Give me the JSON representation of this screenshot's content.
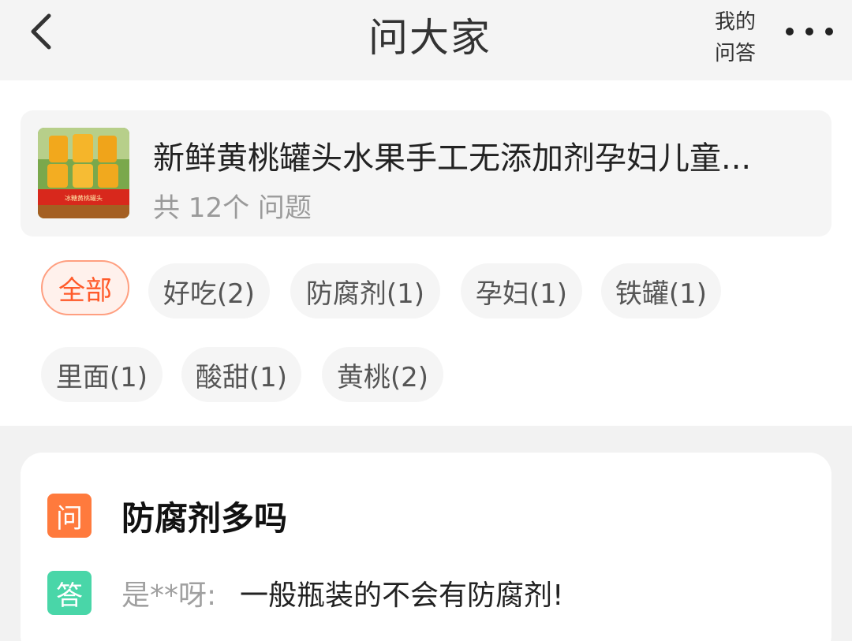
{
  "header": {
    "title": "问大家",
    "my_qa_line1": "我的",
    "my_qa_line2": "问答"
  },
  "product": {
    "title": "新鲜黄桃罐头水果手工无添加剂孕妇儿童...",
    "question_count": "共 12个 问题",
    "thumb_label": "冰糖黄桃罐头"
  },
  "tags": [
    {
      "label": "全部",
      "active": true
    },
    {
      "label": "好吃(2)"
    },
    {
      "label": "防腐剂(1)"
    },
    {
      "label": "孕妇(1)"
    },
    {
      "label": "铁罐(1)"
    },
    {
      "label": "里面(1)"
    },
    {
      "label": "酸甜(1)"
    },
    {
      "label": "黄桃(2)"
    }
  ],
  "qa": {
    "q_badge": "问",
    "question": "防腐剂多吗",
    "a_badge": "答",
    "answer_user": "是**呀:",
    "answer": "一般瓶装的不会有防腐剂!"
  },
  "colors": {
    "accent": "#ff5a2a",
    "question_badge": "#ff7a3d",
    "answer_badge": "#49d6a8"
  },
  "icons": [
    "back-arrow-icon",
    "more-dots-icon"
  ]
}
